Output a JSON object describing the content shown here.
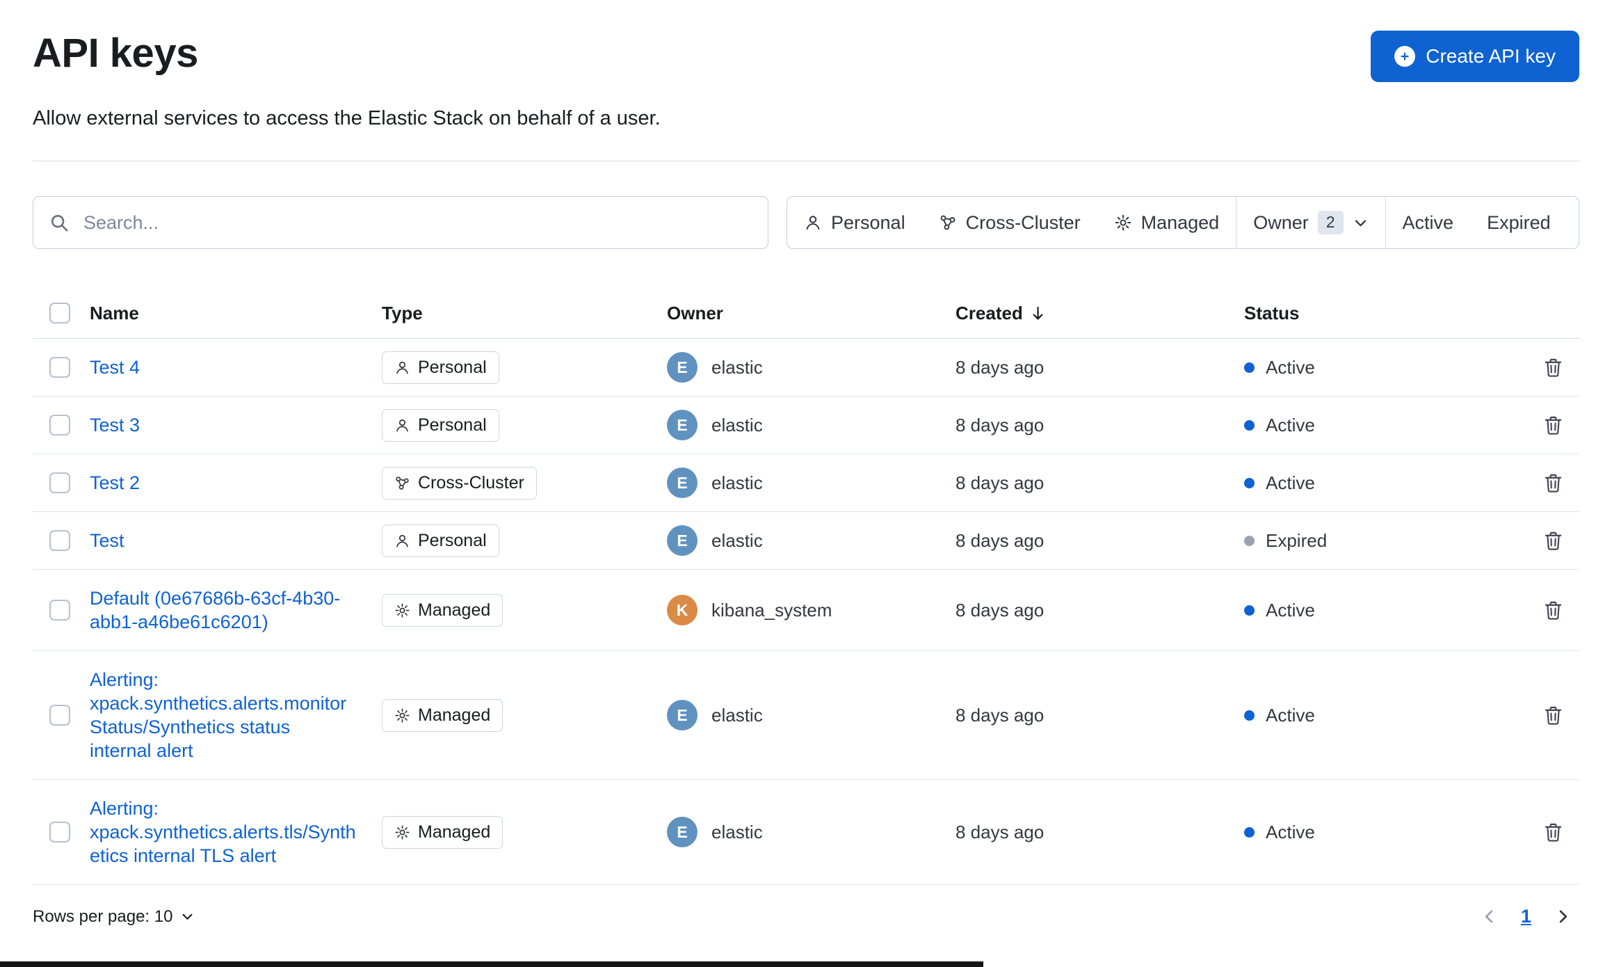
{
  "colors": {
    "accent": "#0e62d2",
    "text": "#343741",
    "title": "#1a1c21",
    "subdued": "#69707d",
    "border": "#d3dae6",
    "avatar_elastic": "#6092c0",
    "avatar_kibana": "#da8b45",
    "status_active": "#0e62d2",
    "status_expired": "#98a2b3"
  },
  "header": {
    "title": "API keys",
    "subtitle": "Allow external services to access the Elastic Stack on behalf of a user.",
    "create_button_label": "Create API key"
  },
  "search": {
    "placeholder": "Search..."
  },
  "filters": {
    "personal_label": "Personal",
    "cross_cluster_label": "Cross-Cluster",
    "managed_label": "Managed",
    "owner_label": "Owner",
    "owner_count": "2",
    "active_label": "Active",
    "expired_label": "Expired"
  },
  "table": {
    "columns": {
      "name": "Name",
      "type": "Type",
      "owner": "Owner",
      "created": "Created",
      "status": "Status"
    },
    "rows": [
      {
        "name": "Test 4",
        "type": "Personal",
        "owner": "elastic",
        "owner_initial": "E",
        "created": "8 days ago",
        "status": "Active"
      },
      {
        "name": "Test 3",
        "type": "Personal",
        "owner": "elastic",
        "owner_initial": "E",
        "created": "8 days ago",
        "status": "Active"
      },
      {
        "name": "Test 2",
        "type": "Cross-Cluster",
        "owner": "elastic",
        "owner_initial": "E",
        "created": "8 days ago",
        "status": "Active"
      },
      {
        "name": "Test",
        "type": "Personal",
        "owner": "elastic",
        "owner_initial": "E",
        "created": "8 days ago",
        "status": "Expired"
      },
      {
        "name": "Default (0e67686b-63cf-4b30-abb1-a46be61c6201)",
        "type": "Managed",
        "owner": "kibana_system",
        "owner_initial": "K",
        "created": "8 days ago",
        "status": "Active"
      },
      {
        "name": "Alerting: xpack.synthetics.alerts.monitorStatus/Synthetics status internal alert",
        "type": "Managed",
        "owner": "elastic",
        "owner_initial": "E",
        "created": "8 days ago",
        "status": "Active"
      },
      {
        "name": "Alerting: xpack.synthetics.alerts.tls/Synthetics internal TLS alert",
        "type": "Managed",
        "owner": "elastic",
        "owner_initial": "E",
        "created": "8 days ago",
        "status": "Active"
      }
    ]
  },
  "footer": {
    "rows_per_page_label": "Rows per page: 10",
    "current_page": "1"
  }
}
